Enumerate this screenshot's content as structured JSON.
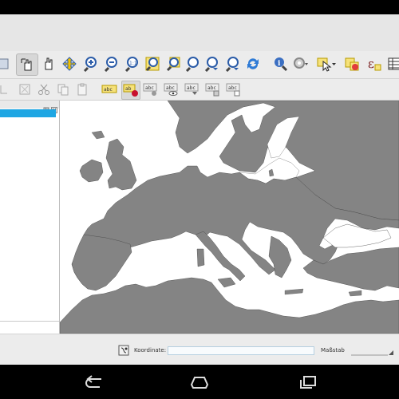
{
  "colors": {
    "land": "#848484",
    "sea": "#ffffff",
    "accent": "#1ea6e3",
    "toolbar": "#ececec"
  },
  "toolbar_main": {
    "buttons": [
      {
        "name": "toggle-editing-icon",
        "selected": false
      },
      {
        "name": "pan-map-icon",
        "selected": true
      },
      {
        "name": "pan-to-selection-icon",
        "selected": false
      },
      {
        "name": "zoom-full-icon",
        "selected": false
      },
      {
        "name": "zoom-in-icon",
        "selected": false
      },
      {
        "name": "zoom-out-icon",
        "selected": false
      },
      {
        "name": "zoom-native-resolution-icon",
        "selected": false
      },
      {
        "name": "zoom-to-selection-icon",
        "selected": false
      },
      {
        "name": "zoom-to-layer-icon",
        "selected": false
      },
      {
        "name": "zoom-last-icon",
        "selected": false
      },
      {
        "name": "zoom-next-icon",
        "selected": false
      },
      {
        "name": "refresh-icon",
        "selected": false
      },
      {
        "name": "identify-features-icon",
        "selected": false
      },
      {
        "name": "action-gear-icon",
        "selected": false
      },
      {
        "name": "select-features-icon",
        "selected": false
      },
      {
        "name": "deselect-features-icon",
        "selected": false
      },
      {
        "name": "expression-select-icon",
        "selected": false
      },
      {
        "name": "attribute-table-icon",
        "selected": false
      }
    ],
    "expression_glyph": "ε"
  },
  "toolbar_labels": {
    "buttons": [
      {
        "name": "move-feature-icon",
        "label": ""
      },
      {
        "name": "delete-selected-icon",
        "label": ""
      },
      {
        "name": "cut-features-icon",
        "label": ""
      },
      {
        "name": "copy-features-icon",
        "label": ""
      },
      {
        "name": "paste-features-icon",
        "label": ""
      },
      {
        "name": "label-tool-icon",
        "label": "abc"
      },
      {
        "name": "pin-labels-icon",
        "label": "ab"
      },
      {
        "name": "highlight-pinned-labels-icon",
        "label": "abc"
      },
      {
        "name": "show-hide-labels-icon",
        "label": "abc"
      },
      {
        "name": "move-label-icon",
        "label": "abc"
      },
      {
        "name": "rotate-label-icon",
        "label": "abc"
      },
      {
        "name": "change-label-icon",
        "label": "abc"
      }
    ]
  },
  "left_panel": {
    "header_buttons": [
      "float-panel-icon",
      "close-panel-icon"
    ],
    "selected_row_label": ""
  },
  "status_bar": {
    "coordinate_label": "Koordinate:",
    "coordinate_value": "",
    "scale_label": "Maßstab",
    "scale_value": ""
  },
  "nav_bar": {
    "buttons": [
      "back-icon",
      "home-icon",
      "recent-apps-icon"
    ]
  }
}
